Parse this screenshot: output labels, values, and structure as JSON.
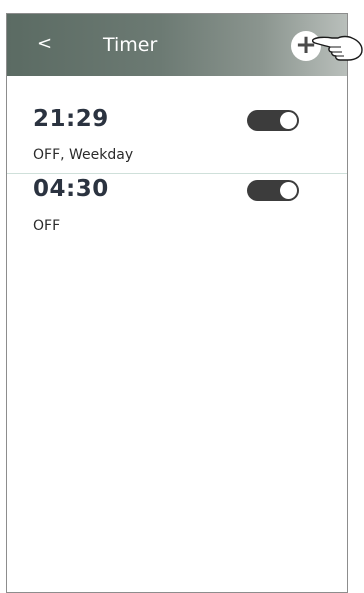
{
  "header": {
    "back_label": "<",
    "title": "Timer",
    "add_label": "+"
  },
  "timers": [
    {
      "time": "21:29",
      "detail": "OFF, Weekday",
      "enabled": true
    },
    {
      "time": "04:30",
      "detail": "OFF",
      "enabled": true
    }
  ],
  "colors": {
    "header_start": "#5b6b63",
    "toggle_on": "#3c3c3c"
  },
  "icons": {
    "add": "plus-icon",
    "pointer": "pointing-hand-icon"
  }
}
